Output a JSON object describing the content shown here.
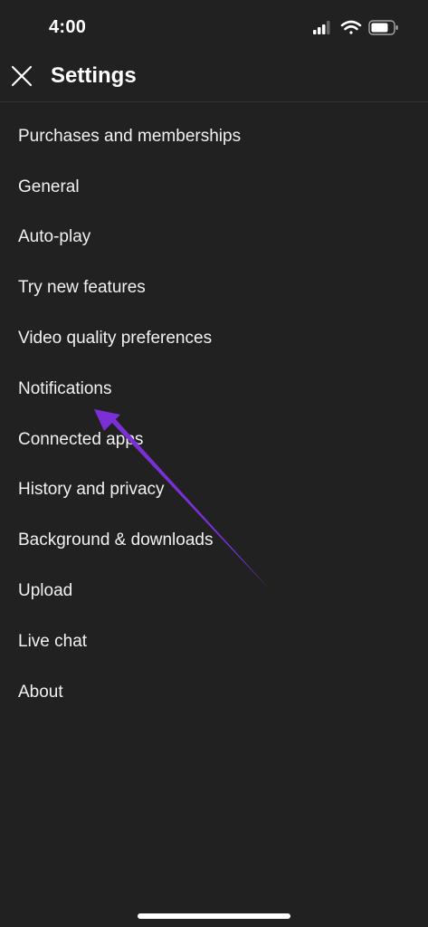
{
  "status_bar": {
    "time": "4:00",
    "icons": [
      "cellular-signal-icon",
      "wifi-icon",
      "battery-icon"
    ]
  },
  "header": {
    "title": "Settings",
    "close_icon": "close-icon"
  },
  "settings": {
    "items": [
      {
        "label": "Purchases and memberships"
      },
      {
        "label": "General"
      },
      {
        "label": "Auto-play"
      },
      {
        "label": "Try new features"
      },
      {
        "label": "Video quality preferences"
      },
      {
        "label": "Notifications"
      },
      {
        "label": "Connected apps"
      },
      {
        "label": "History and privacy"
      },
      {
        "label": "Background & downloads"
      },
      {
        "label": "Upload"
      },
      {
        "label": "Live chat"
      },
      {
        "label": "About"
      }
    ]
  },
  "colors": {
    "background": "#212121",
    "text": "#f1f1f1",
    "annotation_arrow": "#7b2fd6"
  }
}
